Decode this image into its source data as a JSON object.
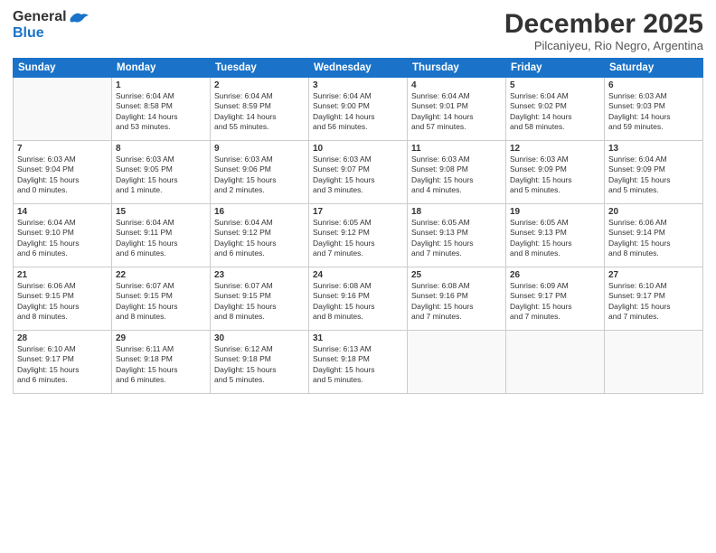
{
  "logo": {
    "general": "General",
    "blue": "Blue"
  },
  "title": "December 2025",
  "subtitle": "Pilcaniyeu, Rio Negro, Argentina",
  "days_of_week": [
    "Sunday",
    "Monday",
    "Tuesday",
    "Wednesday",
    "Thursday",
    "Friday",
    "Saturday"
  ],
  "weeks": [
    [
      {
        "day": "",
        "info": ""
      },
      {
        "day": "1",
        "info": "Sunrise: 6:04 AM\nSunset: 8:58 PM\nDaylight: 14 hours\nand 53 minutes."
      },
      {
        "day": "2",
        "info": "Sunrise: 6:04 AM\nSunset: 8:59 PM\nDaylight: 14 hours\nand 55 minutes."
      },
      {
        "day": "3",
        "info": "Sunrise: 6:04 AM\nSunset: 9:00 PM\nDaylight: 14 hours\nand 56 minutes."
      },
      {
        "day": "4",
        "info": "Sunrise: 6:04 AM\nSunset: 9:01 PM\nDaylight: 14 hours\nand 57 minutes."
      },
      {
        "day": "5",
        "info": "Sunrise: 6:04 AM\nSunset: 9:02 PM\nDaylight: 14 hours\nand 58 minutes."
      },
      {
        "day": "6",
        "info": "Sunrise: 6:03 AM\nSunset: 9:03 PM\nDaylight: 14 hours\nand 59 minutes."
      }
    ],
    [
      {
        "day": "7",
        "info": "Sunrise: 6:03 AM\nSunset: 9:04 PM\nDaylight: 15 hours\nand 0 minutes."
      },
      {
        "day": "8",
        "info": "Sunrise: 6:03 AM\nSunset: 9:05 PM\nDaylight: 15 hours\nand 1 minute."
      },
      {
        "day": "9",
        "info": "Sunrise: 6:03 AM\nSunset: 9:06 PM\nDaylight: 15 hours\nand 2 minutes."
      },
      {
        "day": "10",
        "info": "Sunrise: 6:03 AM\nSunset: 9:07 PM\nDaylight: 15 hours\nand 3 minutes."
      },
      {
        "day": "11",
        "info": "Sunrise: 6:03 AM\nSunset: 9:08 PM\nDaylight: 15 hours\nand 4 minutes."
      },
      {
        "day": "12",
        "info": "Sunrise: 6:03 AM\nSunset: 9:09 PM\nDaylight: 15 hours\nand 5 minutes."
      },
      {
        "day": "13",
        "info": "Sunrise: 6:04 AM\nSunset: 9:09 PM\nDaylight: 15 hours\nand 5 minutes."
      }
    ],
    [
      {
        "day": "14",
        "info": "Sunrise: 6:04 AM\nSunset: 9:10 PM\nDaylight: 15 hours\nand 6 minutes."
      },
      {
        "day": "15",
        "info": "Sunrise: 6:04 AM\nSunset: 9:11 PM\nDaylight: 15 hours\nand 6 minutes."
      },
      {
        "day": "16",
        "info": "Sunrise: 6:04 AM\nSunset: 9:12 PM\nDaylight: 15 hours\nand 6 minutes."
      },
      {
        "day": "17",
        "info": "Sunrise: 6:05 AM\nSunset: 9:12 PM\nDaylight: 15 hours\nand 7 minutes."
      },
      {
        "day": "18",
        "info": "Sunrise: 6:05 AM\nSunset: 9:13 PM\nDaylight: 15 hours\nand 7 minutes."
      },
      {
        "day": "19",
        "info": "Sunrise: 6:05 AM\nSunset: 9:13 PM\nDaylight: 15 hours\nand 8 minutes."
      },
      {
        "day": "20",
        "info": "Sunrise: 6:06 AM\nSunset: 9:14 PM\nDaylight: 15 hours\nand 8 minutes."
      }
    ],
    [
      {
        "day": "21",
        "info": "Sunrise: 6:06 AM\nSunset: 9:15 PM\nDaylight: 15 hours\nand 8 minutes."
      },
      {
        "day": "22",
        "info": "Sunrise: 6:07 AM\nSunset: 9:15 PM\nDaylight: 15 hours\nand 8 minutes."
      },
      {
        "day": "23",
        "info": "Sunrise: 6:07 AM\nSunset: 9:15 PM\nDaylight: 15 hours\nand 8 minutes."
      },
      {
        "day": "24",
        "info": "Sunrise: 6:08 AM\nSunset: 9:16 PM\nDaylight: 15 hours\nand 8 minutes."
      },
      {
        "day": "25",
        "info": "Sunrise: 6:08 AM\nSunset: 9:16 PM\nDaylight: 15 hours\nand 7 minutes."
      },
      {
        "day": "26",
        "info": "Sunrise: 6:09 AM\nSunset: 9:17 PM\nDaylight: 15 hours\nand 7 minutes."
      },
      {
        "day": "27",
        "info": "Sunrise: 6:10 AM\nSunset: 9:17 PM\nDaylight: 15 hours\nand 7 minutes."
      }
    ],
    [
      {
        "day": "28",
        "info": "Sunrise: 6:10 AM\nSunset: 9:17 PM\nDaylight: 15 hours\nand 6 minutes."
      },
      {
        "day": "29",
        "info": "Sunrise: 6:11 AM\nSunset: 9:18 PM\nDaylight: 15 hours\nand 6 minutes."
      },
      {
        "day": "30",
        "info": "Sunrise: 6:12 AM\nSunset: 9:18 PM\nDaylight: 15 hours\nand 5 minutes."
      },
      {
        "day": "31",
        "info": "Sunrise: 6:13 AM\nSunset: 9:18 PM\nDaylight: 15 hours\nand 5 minutes."
      },
      {
        "day": "",
        "info": ""
      },
      {
        "day": "",
        "info": ""
      },
      {
        "day": "",
        "info": ""
      }
    ]
  ]
}
